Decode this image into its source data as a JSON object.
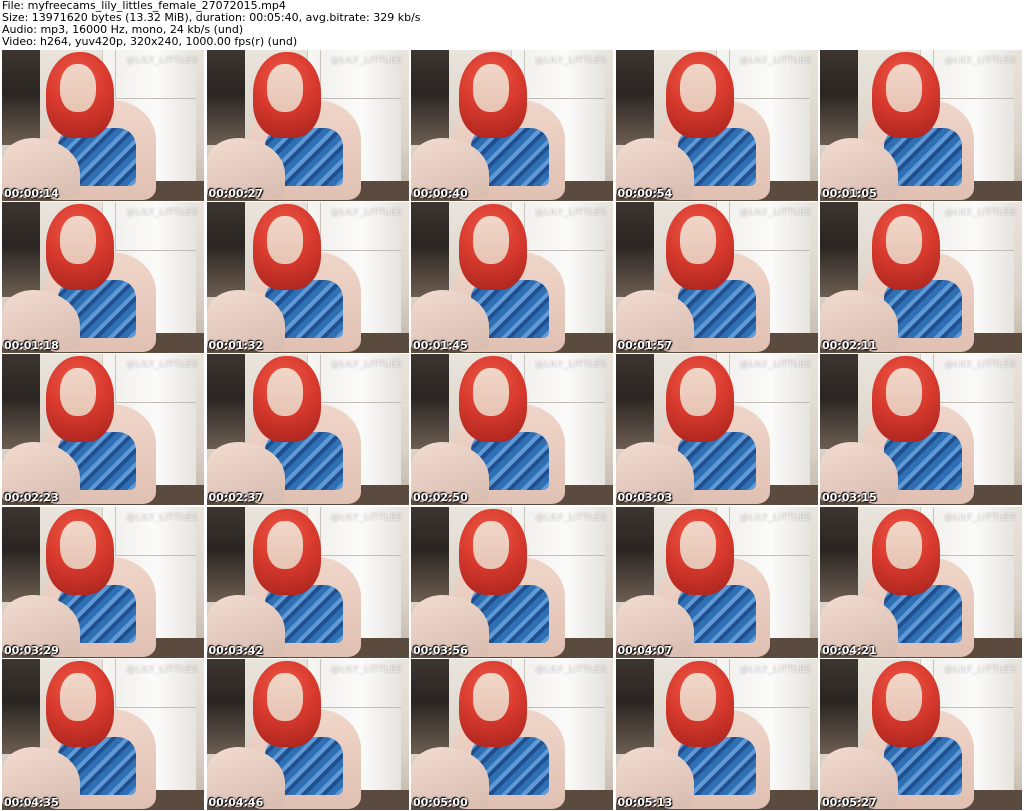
{
  "header": {
    "line1": "File: myfreecams_lily_littles_female_27072015.mp4",
    "line2": "Size: 13971620 bytes (13.32 MiB), duration: 00:05:40, avg.bitrate: 329 kb/s",
    "line3": "Audio: mp3, 16000 Hz, mono, 24 kb/s (und)",
    "line4": "Video: h264, yuv420p, 320x240, 1000.00 fps(r) (und)"
  },
  "watermark_text": "@LILY_LITTLES",
  "colors": {
    "background": "#ffffff",
    "hair": "#d7392d",
    "top": "#2f6fb4",
    "timestamp": "#ffffff"
  },
  "thumbnails": [
    {
      "timestamp": "00:00:14"
    },
    {
      "timestamp": "00:00:27"
    },
    {
      "timestamp": "00:00:40"
    },
    {
      "timestamp": "00:00:54"
    },
    {
      "timestamp": "00:01:05"
    },
    {
      "timestamp": "00:01:18"
    },
    {
      "timestamp": "00:01:32"
    },
    {
      "timestamp": "00:01:45"
    },
    {
      "timestamp": "00:01:57"
    },
    {
      "timestamp": "00:02:11"
    },
    {
      "timestamp": "00:02:23"
    },
    {
      "timestamp": "00:02:37"
    },
    {
      "timestamp": "00:02:50"
    },
    {
      "timestamp": "00:03:03"
    },
    {
      "timestamp": "00:03:15"
    },
    {
      "timestamp": "00:03:29"
    },
    {
      "timestamp": "00:03:42"
    },
    {
      "timestamp": "00:03:56"
    },
    {
      "timestamp": "00:04:07"
    },
    {
      "timestamp": "00:04:21"
    },
    {
      "timestamp": "00:04:35"
    },
    {
      "timestamp": "00:04:46"
    },
    {
      "timestamp": "00:05:00"
    },
    {
      "timestamp": "00:05:13"
    },
    {
      "timestamp": "00:05:27"
    }
  ]
}
